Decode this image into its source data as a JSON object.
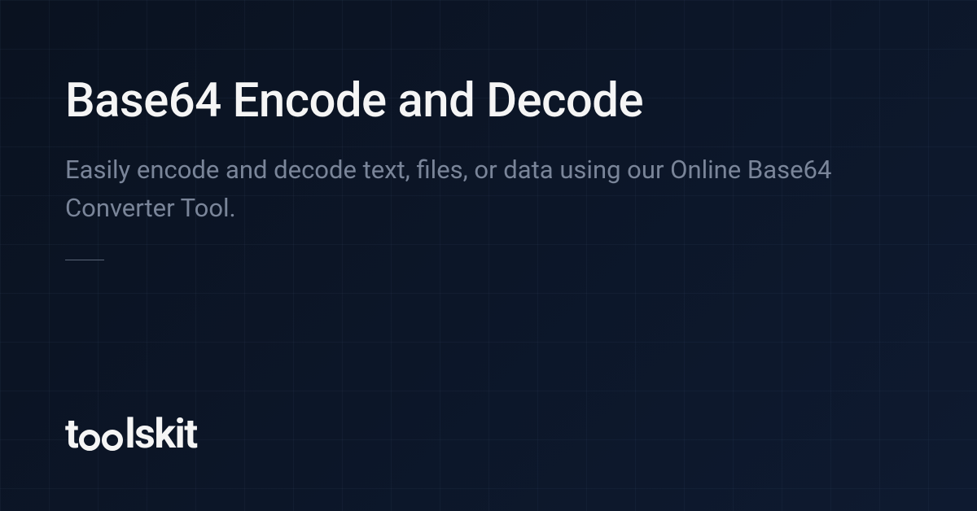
{
  "title": "Base64 Encode and Decode",
  "subtitle": "Easily encode and decode text, files, or data using our Online Base64 Converter Tool.",
  "logo": {
    "prefix": "t",
    "suffix": "lskit"
  }
}
